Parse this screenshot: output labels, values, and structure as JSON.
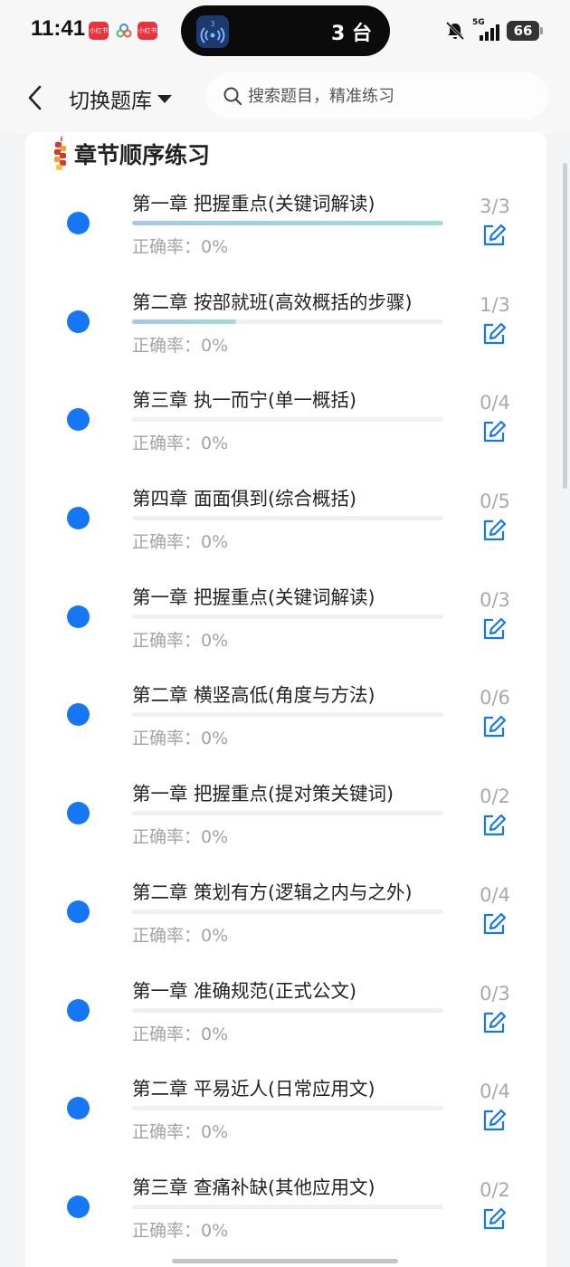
{
  "status_bar": {
    "time": "11:41",
    "notif1": "小红书",
    "notif3": "小红书",
    "island_badge": "3",
    "island_text": "3 台",
    "network": "5G",
    "battery": "66"
  },
  "header": {
    "bank_switch": "切换题库",
    "search_placeholder": "搜索题目，精准练习"
  },
  "section": {
    "title": "章节顺序练习"
  },
  "colors": {
    "accent_blue": "#1677f5",
    "progress_gradient_start": "#a5c8ea",
    "progress_gradient_end": "#9fdbd4"
  },
  "chapters": [
    {
      "title": "第一章 把握重点(关键词解读)",
      "accuracy": "正确率：0%",
      "done": 3,
      "total": 3,
      "count_label": "3/3"
    },
    {
      "title": "第二章 按部就班(高效概括的步骤)",
      "accuracy": "正确率：0%",
      "done": 1,
      "total": 3,
      "count_label": "1/3"
    },
    {
      "title": "第三章 执一而宁(单一概括)",
      "accuracy": "正确率：0%",
      "done": 0,
      "total": 4,
      "count_label": "0/4"
    },
    {
      "title": "第四章 面面俱到(综合概括)",
      "accuracy": "正确率：0%",
      "done": 0,
      "total": 5,
      "count_label": "0/5"
    },
    {
      "title": "第一章 把握重点(关键词解读)",
      "accuracy": "正确率：0%",
      "done": 0,
      "total": 3,
      "count_label": "0/3"
    },
    {
      "title": "第二章 横竖高低(角度与方法)",
      "accuracy": "正确率：0%",
      "done": 0,
      "total": 6,
      "count_label": "0/6"
    },
    {
      "title": "第一章 把握重点(提对策关键词)",
      "accuracy": "正确率：0%",
      "done": 0,
      "total": 2,
      "count_label": "0/2"
    },
    {
      "title": "第二章 策划有方(逻辑之内与之外)",
      "accuracy": "正确率：0%",
      "done": 0,
      "total": 4,
      "count_label": "0/4"
    },
    {
      "title": "第一章 准确规范(正式公文)",
      "accuracy": "正确率：0%",
      "done": 0,
      "total": 3,
      "count_label": "0/3"
    },
    {
      "title": "第二章 平易近人(日常应用文)",
      "accuracy": "正确率：0%",
      "done": 0,
      "total": 4,
      "count_label": "0/4"
    },
    {
      "title": "第三章 查痛补缺(其他应用文)",
      "accuracy": "正确率：0%",
      "done": 0,
      "total": 2,
      "count_label": "0/2"
    }
  ]
}
